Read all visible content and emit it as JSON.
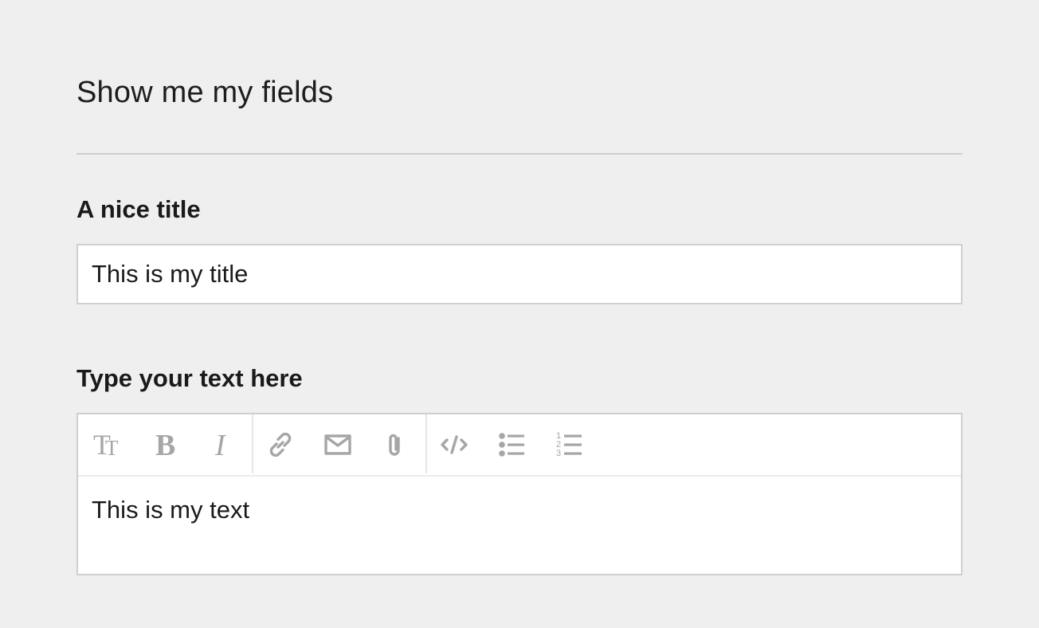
{
  "page": {
    "title": "Show me my fields"
  },
  "fields": {
    "title_field": {
      "label": "A nice title",
      "value": "This is my title"
    },
    "text_field": {
      "label": "Type your text here",
      "value": "This is my text"
    }
  },
  "toolbar": {
    "icons": [
      "heading-icon",
      "bold-icon",
      "italic-icon",
      "link-icon",
      "email-icon",
      "attachment-icon",
      "code-icon",
      "bullet-list-icon",
      "numbered-list-icon"
    ],
    "numbered_list_digits": [
      "1",
      "2",
      "3"
    ],
    "icon_color": "#a6a6a6"
  },
  "colors": {
    "background": "#efefef",
    "border": "#cfcfcf",
    "field_background": "#ffffff",
    "text": "#1a1a1a"
  }
}
